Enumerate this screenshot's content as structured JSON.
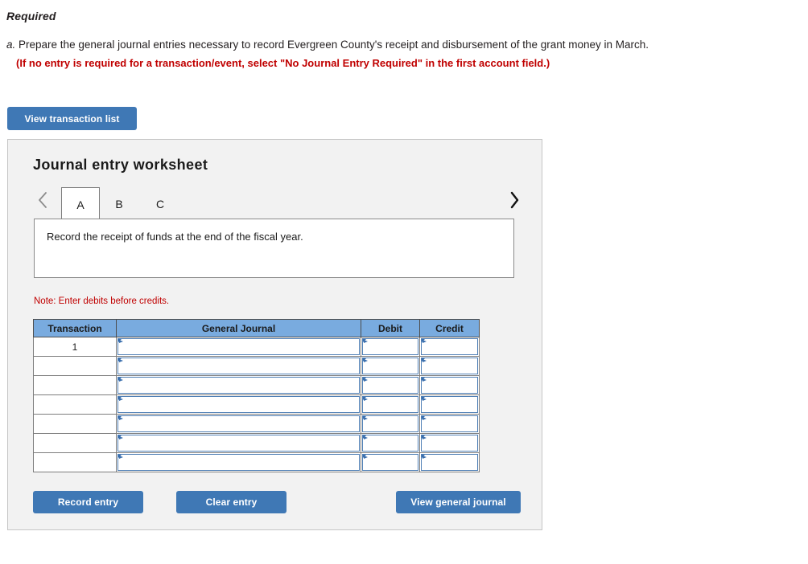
{
  "page": {
    "required_heading": "Required",
    "instruction_letter": "a.",
    "instruction_text": "Prepare the general journal entries necessary to record Evergreen County's receipt and disbursement of the grant money in March.",
    "instruction_note": "(If no entry is required for a transaction/event, select \"No Journal Entry Required\" in the first account field.)"
  },
  "toolbar": {
    "view_transaction_list_label": "View transaction list"
  },
  "worksheet": {
    "title": "Journal entry worksheet",
    "prev_icon": "chevron-left-icon",
    "next_icon": "chevron-right-icon",
    "tabs": [
      {
        "label": "A",
        "active": true
      },
      {
        "label": "B",
        "active": false
      },
      {
        "label": "C",
        "active": false
      }
    ],
    "description": "Record the receipt of funds at the end of the fiscal year.",
    "note": "Note: Enter debits before credits.",
    "table": {
      "headers": [
        "Transaction",
        "General Journal",
        "Debit",
        "Credit"
      ],
      "rows": [
        {
          "transaction": "1",
          "general_journal": "",
          "debit": "",
          "credit": ""
        },
        {
          "transaction": "",
          "general_journal": "",
          "debit": "",
          "credit": ""
        },
        {
          "transaction": "",
          "general_journal": "",
          "debit": "",
          "credit": ""
        },
        {
          "transaction": "",
          "general_journal": "",
          "debit": "",
          "credit": ""
        },
        {
          "transaction": "",
          "general_journal": "",
          "debit": "",
          "credit": ""
        },
        {
          "transaction": "",
          "general_journal": "",
          "debit": "",
          "credit": ""
        },
        {
          "transaction": "",
          "general_journal": "",
          "debit": "",
          "credit": ""
        }
      ]
    },
    "actions": {
      "record_entry_label": "Record entry",
      "clear_entry_label": "Clear entry",
      "view_general_journal_label": "View general journal"
    }
  },
  "colors": {
    "button_blue": "#3f78b5",
    "table_header_blue": "#79abdf",
    "field_border_blue": "#4f7fb5",
    "alert_red": "#c00000",
    "panel_background": "#f2f2f2",
    "panel_border": "#c6c6c6"
  }
}
